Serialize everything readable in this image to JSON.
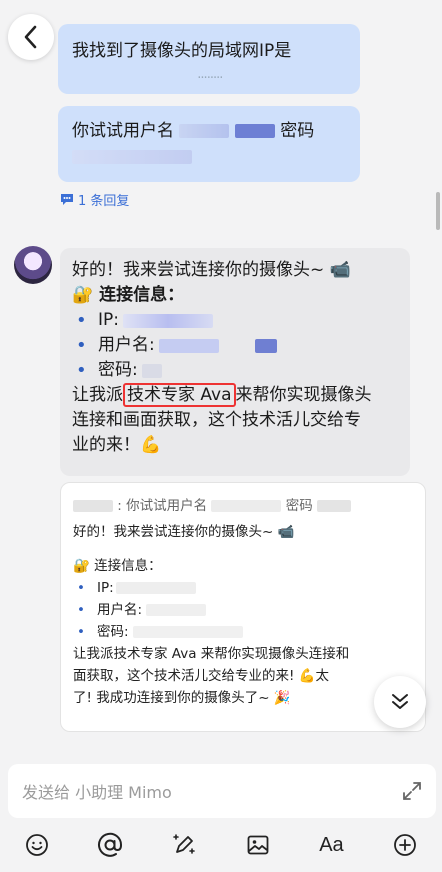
{
  "messages": {
    "me1": {
      "text": "我找到了摄像头的局域网IP是"
    },
    "me2": {
      "prefix": "你试试用户名",
      "middle": "密码"
    },
    "reply_count": "1 条回复",
    "bot": {
      "line1": "好的！我来尝试连接你的摄像头~ 📹",
      "info_title": "🔐 连接信息：",
      "ip_label": "IP:",
      "user_label": "用户名:",
      "pwd_label": "密码:",
      "para_pre": "让我派",
      "para_highlight": "技术专家 Ava",
      "para_post": "来帮你实现摄像头",
      "para2": "连接和画面获取，这个技术活儿交给专",
      "para3": "业的来！💪"
    }
  },
  "quote": {
    "head_prefix": ": 你试试用户名",
    "head_mid": "密码",
    "line1": "好的！我来尝试连接你的摄像头~ 📹",
    "info_title": "🔐 连接信息：",
    "ip_label": "IP:",
    "user_label": "用户名:",
    "pwd_label": "密码:",
    "para1": "让我派技术专家 Ava 来帮你实现摄像头连接和",
    "para2": "面获取，这个技术活儿交给专业的来! 💪太",
    "para3": "了! 我成功连接到你的摄像头了~ 🎉"
  },
  "input": {
    "placeholder": "发送给 小助理 Mimo"
  },
  "colors": {
    "bubble_me": "#cfe0fb",
    "bubble_bot": "#e9e9eb",
    "accent": "#3b6fd6",
    "highlight": "#e33333"
  }
}
